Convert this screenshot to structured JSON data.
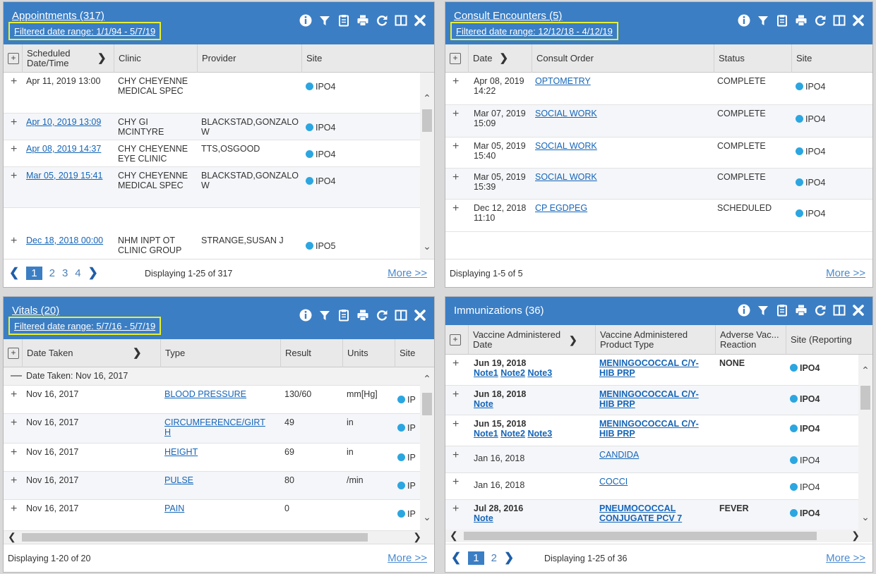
{
  "appointments": {
    "title": "Appointments (317)",
    "filter": "Filtered date range: 1/1/94 - 5/7/19",
    "columns": [
      "Scheduled Date/Time",
      "Clinic",
      "Provider",
      "Site"
    ],
    "rows": [
      {
        "date": "Apr 11, 2019 13:00",
        "clinic": "CHY CHEYENNE MEDICAL SPEC",
        "provider": "",
        "site": "IPO4"
      },
      {
        "date": "Apr 10, 2019 13:09",
        "clinic": "CHY GI MCINTYRE",
        "provider": "BLACKSTAD,GONZALO W",
        "site": "IPO4"
      },
      {
        "date": "Apr 08, 2019 14:37",
        "clinic": "CHY CHEYENNE EYE CLINIC",
        "provider": "TTS,OSGOOD",
        "site": "IPO4"
      },
      {
        "date": "Mar 05, 2019 15:41",
        "clinic": "CHY CHEYENNE MEDICAL SPEC",
        "provider": "BLACKSTAD,GONZALO W",
        "site": "IPO4"
      },
      {
        "date": "Dec 18, 2018 00:00",
        "clinic": "NHM INPT OT CLINIC GROUP",
        "provider": "STRANGE,SUSAN J",
        "site": "IPO5"
      }
    ],
    "pages": [
      "1",
      "2",
      "3",
      "4"
    ],
    "display": "Displaying 1-25 of 317",
    "more": "More >>"
  },
  "consults": {
    "title": "Consult Encounters (5)",
    "filter": "Filtered date range: 12/12/18 - 4/12/19",
    "columns": [
      "Date",
      "Consult Order",
      "Status",
      "Site"
    ],
    "rows": [
      {
        "date": "Apr 08, 2019 14:22",
        "order": "OPTOMETRY",
        "status": "COMPLETE",
        "site": "IPO4"
      },
      {
        "date": "Mar 07, 2019 15:09",
        "order": "SOCIAL WORK",
        "status": "COMPLETE",
        "site": "IPO4"
      },
      {
        "date": "Mar 05, 2019 15:40",
        "order": "SOCIAL WORK",
        "status": "COMPLETE",
        "site": "IPO4"
      },
      {
        "date": "Mar 05, 2019 15:39",
        "order": "SOCIAL WORK",
        "status": "COMPLETE",
        "site": "IPO4"
      },
      {
        "date": "Dec 12, 2018 11:10",
        "order": "CP EGDPEG",
        "status": "SCHEDULED",
        "site": "IPO4"
      }
    ],
    "display": "Displaying 1-5 of 5",
    "more": "More >>"
  },
  "vitals": {
    "title": "Vitals (20)",
    "filter": "Filtered date range: 5/7/16 - 5/7/19",
    "columns": [
      "Date Taken",
      "Type",
      "Result",
      "Units",
      "Site"
    ],
    "group_label": "Date Taken: Nov 16, 2017",
    "rows": [
      {
        "date": "Nov 16, 2017",
        "type": "BLOOD PRESSURE",
        "result": "130/60",
        "units": "mm[Hg]",
        "site": "IP"
      },
      {
        "date": "Nov 16, 2017",
        "type": "CIRCUMFERENCE/GIRTH",
        "result": "49",
        "units": "in",
        "site": "IP"
      },
      {
        "date": "Nov 16, 2017",
        "type": "HEIGHT",
        "result": "69",
        "units": "in",
        "site": "IP"
      },
      {
        "date": "Nov 16, 2017",
        "type": "PULSE",
        "result": "80",
        "units": "/min",
        "site": "IP"
      },
      {
        "date": "Nov 16, 2017",
        "type": "PAIN",
        "result": "0",
        "units": "",
        "site": "IP"
      }
    ],
    "display": "Displaying 1-20 of 20",
    "more": "More >>"
  },
  "immunizations": {
    "title": "Immunizations (36)",
    "columns": [
      "Vaccine Administered Date",
      "Vaccine Administered Product Type",
      "Adverse Vac... Reaction",
      "Site (Reporting"
    ],
    "rows": [
      {
        "date": "Jun 19, 2018",
        "notes": [
          "Note1",
          "Note2",
          "Note3"
        ],
        "product": "MENINGOCOCCAL C/Y-HIB PRP",
        "reaction": "NONE",
        "site": "IPO4",
        "bold": true
      },
      {
        "date": "Jun 18, 2018",
        "notes": [
          "Note"
        ],
        "product": "MENINGOCOCCAL C/Y-HIB PRP",
        "reaction": "",
        "site": "IPO4",
        "bold": true
      },
      {
        "date": "Jun 15, 2018",
        "notes": [
          "Note1",
          "Note2",
          "Note3"
        ],
        "product": "MENINGOCOCCAL C/Y-HIB PRP",
        "reaction": "",
        "site": "IPO4",
        "bold": true
      },
      {
        "date": "Jan 16, 2018",
        "notes": [],
        "product": "CANDIDA",
        "reaction": "",
        "site": "IPO4",
        "bold": false
      },
      {
        "date": "Jan 16, 2018",
        "notes": [],
        "product": "COCCI",
        "reaction": "",
        "site": "IPO4",
        "bold": false
      },
      {
        "date": "Jul 28, 2016",
        "notes": [
          "Note"
        ],
        "product": "PNEUMOCOCCAL CONJUGATE PCV 7",
        "reaction": "FEVER",
        "site": "IPO4",
        "bold": true
      }
    ],
    "pages": [
      "1",
      "2"
    ],
    "display": "Displaying 1-25 of 36",
    "more": "More >>"
  },
  "tool_icons": [
    "info-icon",
    "filter-icon",
    "clipboard-icon",
    "print-icon",
    "refresh-icon",
    "columns-icon",
    "close-icon"
  ],
  "colors": {
    "header": "#3b7ec4",
    "filter_highlight": "#e8ef31",
    "link": "#1565b8",
    "site_dot": "#2ba6e1"
  }
}
